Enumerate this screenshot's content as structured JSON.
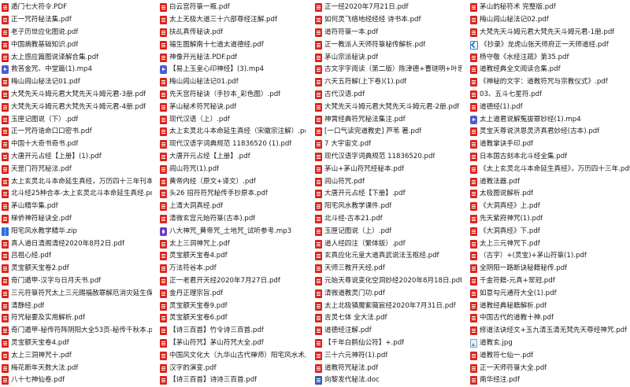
{
  "columns": [
    [
      {
        "name": "遁门七大符令.PDF",
        "icon": "pdf"
      },
      {
        "name": "正一咒符秘法集.pdf",
        "icon": "pdf"
      },
      {
        "name": "老子历世应化图说.pdf",
        "icon": "pdf"
      },
      {
        "name": "中国病教基础知识.pdf",
        "icon": "pdf"
      },
      {
        "name": "太上感应篇图说译解合集.pdf",
        "icon": "pdf"
      },
      {
        "name": "救苦金咒、中堂篇(1).mp4",
        "icon": "mp4"
      },
      {
        "name": "梅山闾山秘法记01.pdf",
        "icon": "pdf"
      },
      {
        "name": "大梵先天斗姆元君大梵先天斗姆元君-3册.pdf",
        "icon": "pdf"
      },
      {
        "name": "大梵先天斗姆元君大梵先天斗姆元君-4册.pdf",
        "icon": "pdf"
      },
      {
        "name": "玉匣记图说（下）.pdf",
        "icon": "pdf"
      },
      {
        "name": "正一咒符诰命口口密书.pdf",
        "icon": "pdf"
      },
      {
        "name": "中国十大奇书奇书.pdf",
        "icon": "pdf"
      },
      {
        "name": "大唐开元占经【上册】(1).pdf",
        "icon": "pdf"
      },
      {
        "name": "天罡门符咒秘法.pdf",
        "icon": "pdf"
      },
      {
        "name": "太上玄灵北斗本命延生真经，万历四十三年刊本.pdf",
        "icon": "pdf"
      },
      {
        "name": "北斗经25种合本-太上玄灵北斗本命延生真经.pdf",
        "icon": "pdf"
      },
      {
        "name": "茅山精华集.pdf",
        "icon": "pdf"
      },
      {
        "name": "梯侨神符秘诀全.pdf",
        "icon": "pdf"
      },
      {
        "name": "阳宅风水教学精华.zip",
        "icon": "zip"
      },
      {
        "name": "真人道日清阁清经2020年8月2日.pdf",
        "icon": "pdf"
      },
      {
        "name": "吕祖心经.pdf",
        "icon": "pdf"
      },
      {
        "name": "灵宝额天宝卷2.pdf",
        "icon": "pdf"
      },
      {
        "name": "奇门遁甲-汉字与日月天书.pdf",
        "icon": "pdf"
      },
      {
        "name": "三元符箓符咒太上三元赐福赦罪解厄消灾延生保命妙经.pdf",
        "icon": "pdf"
      },
      {
        "name": "清静经.pdf",
        "icon": "pdf"
      },
      {
        "name": "符咒秘要及实用解析.pdf",
        "icon": "pdf"
      },
      {
        "name": "奇门遁甲-秘传符阵阴阳大全53页-秘传千秋本.pdf",
        "icon": "pdf"
      },
      {
        "name": "灵宝额天宝卷4.pdf",
        "icon": "pdf"
      },
      {
        "name": "太上三洞神咒十.pdf",
        "icon": "pdf"
      },
      {
        "name": "梅花断年天数大法.pdf",
        "icon": "pdf"
      },
      {
        "name": "八十七神仙卷.pdf",
        "icon": "pdf"
      }
    ],
    [
      {
        "name": "白云宫符箓一瓶.pdf",
        "icon": "pdf"
      },
      {
        "name": "太上无极大道三十六部尊经注解.pdf",
        "icon": "pdf"
      },
      {
        "name": "扶乩真传秘诀.pdf",
        "icon": "pdf"
      },
      {
        "name": "福生图解南十七道太道德经.pdf",
        "icon": "pdf"
      },
      {
        "name": "神像开光秘法.PDF.pdf",
        "icon": "pdf"
      },
      {
        "name": "【易上玉皇心印神经】(3).mp4",
        "icon": "mp4"
      },
      {
        "name": "梅山闾山秘法记01.pdf",
        "icon": "pdf"
      },
      {
        "name": "先天宫符秘诀（手抄本_彩色图）.pdf",
        "icon": "pdf"
      },
      {
        "name": "茅山秘术符咒秘诀.pdf",
        "icon": "pdf"
      },
      {
        "name": "现代汉语（上）.pdf",
        "icon": "pdf"
      },
      {
        "name": "太上玄灵北斗本命延生真经（宋徽宗注解）.pdf",
        "icon": "pdf"
      },
      {
        "name": "现代汉语字词典规范 11836520 (1).pdf",
        "icon": "pdf"
      },
      {
        "name": "大唐开元占经【上册】.pdf",
        "icon": "pdf"
      },
      {
        "name": "闾山符咒(1).pdf",
        "icon": "pdf"
      },
      {
        "name": "黄帝内经（原文+译文）.pdf",
        "icon": "pdf"
      },
      {
        "name": "头26 招符符咒秘传手抄原本.pdf",
        "icon": "pdf"
      },
      {
        "name": "上清大洞真经.pdf",
        "icon": "pdf"
      },
      {
        "name": "清微玄宫元始符箓(古本).pdf",
        "icon": "pdf"
      },
      {
        "name": "八大神咒_黄帝咒_土地咒_试听参考.mp3",
        "icon": "mp3"
      },
      {
        "name": "太上三洞神咒上.pdf",
        "icon": "pdf"
      },
      {
        "name": "灵宝额天宝卷4.pdf",
        "icon": "pdf"
      },
      {
        "name": "万法符谷本.pdf",
        "icon": "pdf"
      },
      {
        "name": "正一老君开天经2020年7月27日.pdf",
        "icon": "pdf"
      },
      {
        "name": "金丹正理宗旨.pdf",
        "icon": "pdf"
      },
      {
        "name": "灵宝额天宝卷9.pdf",
        "icon": "pdf"
      },
      {
        "name": "灵宝额天宝卷6.pdf",
        "icon": "pdf"
      },
      {
        "name": "【诗三百首】竹令诗三百首.pdf",
        "icon": "pdf"
      },
      {
        "name": "【茅山符咒】茅山符咒大全.pdf",
        "icon": "pdf"
      },
      {
        "name": "中国风文化大（九华山古代禅师）阳宅风水术原名(秘).pdf",
        "icon": "pdf"
      },
      {
        "name": "汉字的演变.pdf",
        "icon": "pdf"
      },
      {
        "name": "【诗三百首】诗诗三百首.pdf",
        "icon": "pdf"
      }
    ],
    [
      {
        "name": "正一经2020年7月21日.pdf",
        "icon": "pdf"
      },
      {
        "name": "如何灵飞络地经经经 诗书本.pdf",
        "icon": "pdf"
      },
      {
        "name": "道符符箓一本.pdf",
        "icon": "pdf"
      },
      {
        "name": "正一教派人天师符箓秘传解析.pdf",
        "icon": "pdf"
      },
      {
        "name": "茅山宗派秘诀.pdf",
        "icon": "pdf"
      },
      {
        "name": "古文字字阅读（第二版）陈津德+曹琏明+叶思.pdf",
        "icon": "pdf"
      },
      {
        "name": "六天五符解(上下卷)(1).pdf",
        "icon": "pdf"
      },
      {
        "name": "古代汉语.pdf",
        "icon": "pdf"
      },
      {
        "name": "大梵先天斗姆元君大梵先天斗姆元君-2册.pdf",
        "icon": "pdf"
      },
      {
        "name": "神霄经典符咒秘法集注.pdf",
        "icon": "pdf"
      },
      {
        "name": "[一口气读完道教史] 芦苇 著.pdf",
        "icon": "pdf"
      },
      {
        "name": "7 大宇宙文.pdf",
        "icon": "pdf"
      },
      {
        "name": "现代汉语字词典规范 11836520.pdf",
        "icon": "pdf"
      },
      {
        "name": "茅山+茅山符咒经秘本.pdf",
        "icon": "pdf"
      },
      {
        "name": "闾山符咒.pdf",
        "icon": "pdf"
      },
      {
        "name": "大唐开元占经【下册】.pdf",
        "icon": "pdf"
      },
      {
        "name": "阳宅风水教学课件.pdf",
        "icon": "pdf"
      },
      {
        "name": "北斗经-古本21.pdf",
        "icon": "pdf"
      },
      {
        "name": "玉匣记图说（上）.pdf",
        "icon": "pdf"
      },
      {
        "name": "道人经四注（繁体版）.pdf",
        "icon": "pdf"
      },
      {
        "name": "玄真应化元皇大道真武说法玉枢经.pdf",
        "icon": "pdf"
      },
      {
        "name": "天师三教开天经.pdf",
        "icon": "pdf"
      },
      {
        "name": "元始天尊说变化空洞妙经2020年8月18日.pdf",
        "icon": "pdf"
      },
      {
        "name": "清微道教灵门功.pdf",
        "icon": "pdf"
      },
      {
        "name": "太上北极镇魔紫薇宸经2020年7月31日.pdf",
        "icon": "pdf"
      },
      {
        "name": "吉灵七体 全大法.pdf",
        "icon": "pdf"
      },
      {
        "name": "道德经注解.pdf",
        "icon": "pdf"
      },
      {
        "name": "【千年白鹤仙公符】+.pdf",
        "icon": "pdf"
      },
      {
        "name": "三十六元神符(1).pdf",
        "icon": "pdf"
      },
      {
        "name": "道教符咒秘法.pdf",
        "icon": "pdf"
      },
      {
        "name": "向黎发代秘法.doc",
        "icon": "doc"
      }
    ],
    [
      {
        "name": "茅山的秘符术 完整版.pdf",
        "icon": "pdf"
      },
      {
        "name": "梅山闾山秘法记02.pdf",
        "icon": "pdf"
      },
      {
        "name": "大梵先天斗姆元君大梵先天斗姆元君-1册.pdf",
        "icon": "pdf"
      },
      {
        "name": "《抄录》龙虎山张天师府正一天师道经.pdf",
        "icon": "link"
      },
      {
        "name": "杨守敬《水经注疏》第35.pdf",
        "icon": "pdf"
      },
      {
        "name": "道教经典全文阅读合集.pdf",
        "icon": "pdf"
      },
      {
        "name": "《神秘的文字：道教符咒与宗教仪式》.pdf",
        "icon": "pdf"
      },
      {
        "name": "03、五斗七星符.pdf",
        "icon": "pdf"
      },
      {
        "name": "道德经(1).pdf",
        "icon": "pdf"
      },
      {
        "name": "太上道君说解冤拔罪妙经(1).mp4",
        "icon": "mp4"
      },
      {
        "name": "灵宝天尊说洪恩灵济真君妙经(古本).pdf",
        "icon": "pdf"
      },
      {
        "name": "道教掌诀手印.pdf",
        "icon": "pdf"
      },
      {
        "name": "日本国古刻本北斗经全集.pdf",
        "icon": "pdf"
      },
      {
        "name": "《太上玄灵北斗本命延生真经》，万历四十三年.pdf",
        "icon": "pdf"
      },
      {
        "name": "道教法器.pdf",
        "icon": "pdf"
      },
      {
        "name": "太极图说解析.pdf",
        "icon": "pdf"
      },
      {
        "name": "《大洞真经》上.pdf",
        "icon": "pdf"
      },
      {
        "name": "先天紫府神咒(1).pdf",
        "icon": "pdf"
      },
      {
        "name": "《大洞真经》下.pdf",
        "icon": "pdf"
      },
      {
        "name": "太上三元神咒下.pdf",
        "icon": "pdf"
      },
      {
        "name": "（古字）+(灵宝)+茅山符箓(1).pdf",
        "icon": "pdf"
      },
      {
        "name": "全阴阳一路断诀秘籍秘传.pdf",
        "icon": "pdf"
      },
      {
        "name": "千金符籍-元真+翠冠.pdf",
        "icon": "pdf"
      },
      {
        "name": "如意勾元通符大全(1).pdf",
        "icon": "pdf"
      },
      {
        "name": "道教经典秘籍解析.pdf",
        "icon": "pdf"
      },
      {
        "name": "中国古代的道教十神.pdf",
        "icon": "pdf"
      },
      {
        "name": "修道法诀经文+玉九清玉清无梵先天尊经神咒.pdf",
        "icon": "pdf"
      },
      {
        "name": "道教玄.jpg",
        "icon": "jpg"
      },
      {
        "name": "道教符七仙一.pdf",
        "icon": "pdf"
      },
      {
        "name": "正一天师符箓大全.pdf",
        "icon": "pdf"
      },
      {
        "name": "南华经注.pdf",
        "icon": "pdf"
      }
    ]
  ]
}
